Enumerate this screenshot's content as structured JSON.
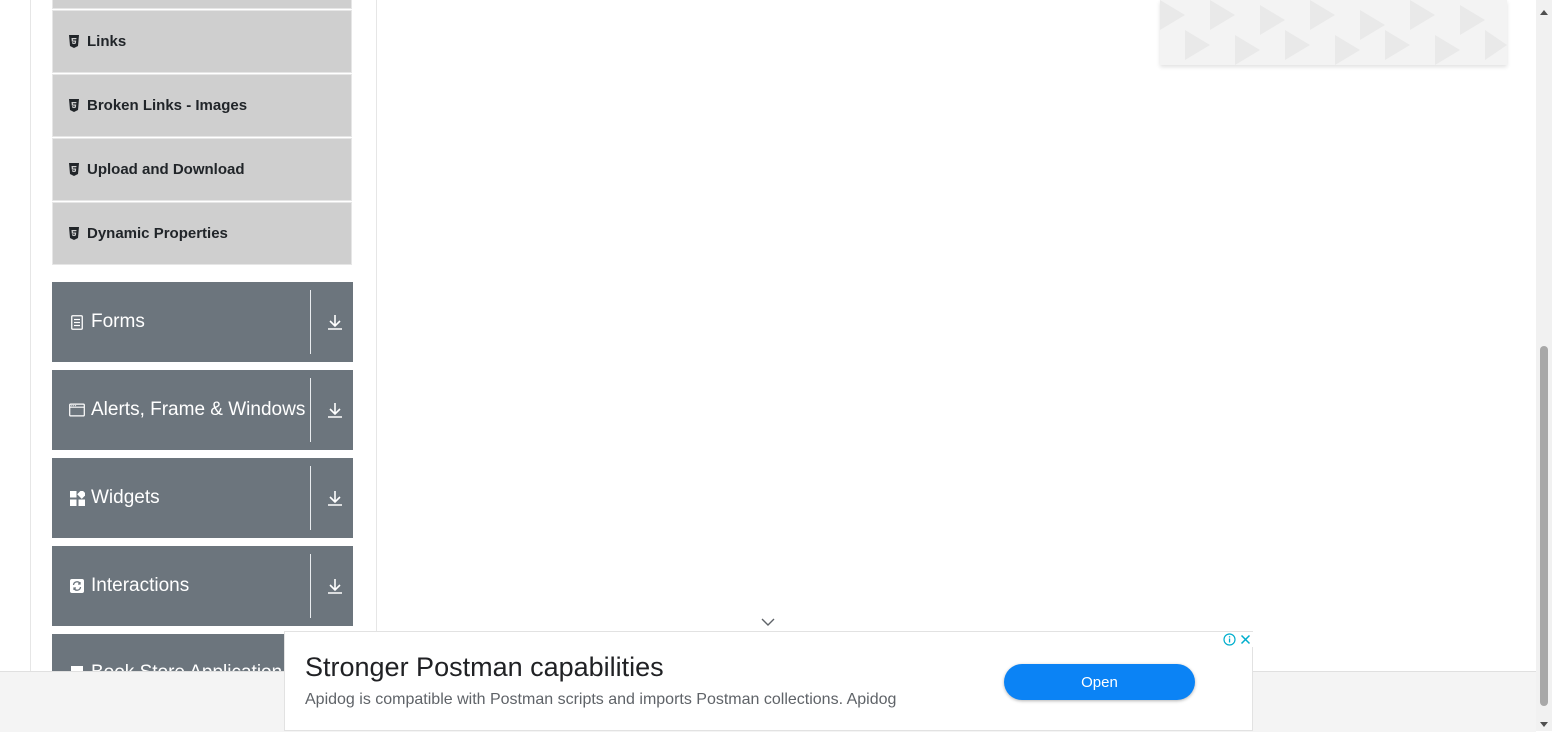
{
  "sidebar": {
    "sub_items": [
      {
        "label": "Links",
        "icon": "html5-icon"
      },
      {
        "label": "Broken Links - Images",
        "icon": "html5-icon"
      },
      {
        "label": "Upload and Download",
        "icon": "html5-icon"
      },
      {
        "label": "Dynamic Properties",
        "icon": "html5-icon"
      }
    ],
    "groups": [
      {
        "label": "Forms",
        "icon": "document-icon"
      },
      {
        "label": "Alerts, Frame & Windows",
        "icon": "window-icon"
      },
      {
        "label": "Widgets",
        "icon": "widgets-icon"
      },
      {
        "label": "Interactions",
        "icon": "interactions-icon"
      },
      {
        "label": "Book Store Application",
        "icon": "book-icon"
      }
    ]
  },
  "ad": {
    "title": "Stronger Postman capabilities",
    "description": "Apidog is compatible with Postman scripts and imports Postman collections. Apidog",
    "open_label": "Open"
  },
  "colors": {
    "group_bg": "#6c757d",
    "sub_item_bg": "#cfcfcf",
    "ad_button": "#0b83f5"
  }
}
